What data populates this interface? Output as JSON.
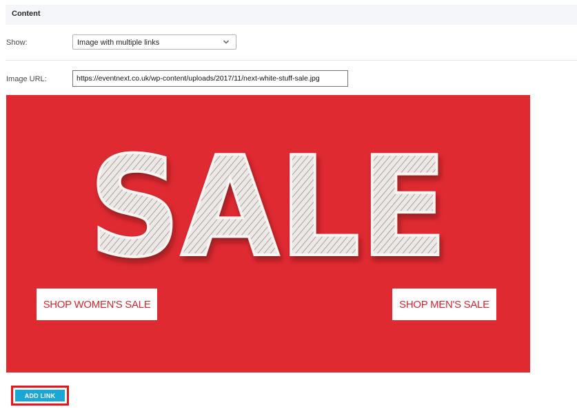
{
  "section": {
    "title": "Content"
  },
  "show": {
    "label": "Show:",
    "selected": "Image with multiple links"
  },
  "image_url": {
    "label": "Image URL:",
    "value": "https://eventnext.co.uk/wp-content/uploads/2017/11/next-white-stuff-sale.jpg"
  },
  "banner": {
    "headline": "SALE",
    "links": [
      "SHOP WOMEN'S SALE",
      "SHOP MEN'S SALE"
    ],
    "background": "#df2a32"
  },
  "actions": {
    "add_link": "ADD LINK"
  },
  "colors": {
    "accent": "#1ba6d6",
    "highlight": "#e8141c",
    "banner_text": "#d8252e"
  },
  "icons": [
    "chevron-down-icon"
  ]
}
